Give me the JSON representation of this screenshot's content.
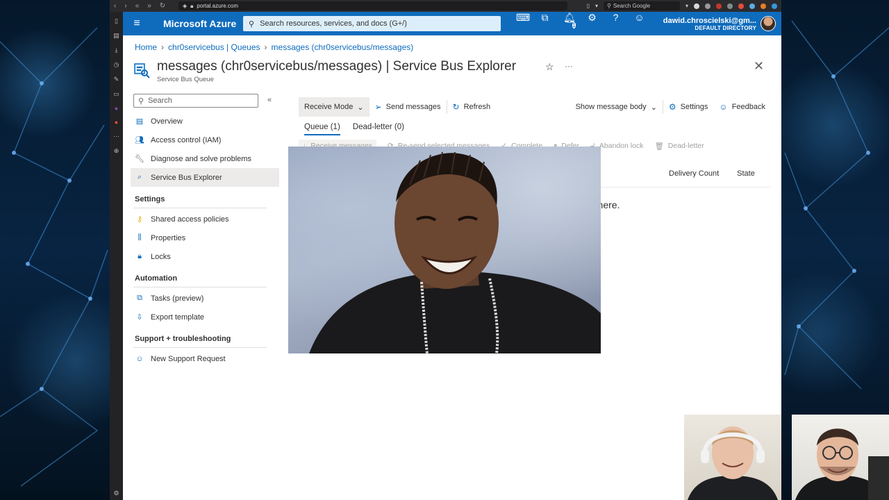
{
  "browser": {
    "url": "portal.azure.com",
    "google_search": "Search Google"
  },
  "topbar": {
    "brand": "Microsoft Azure",
    "search_placeholder": "Search resources, services, and docs (G+/)",
    "notification_count": "1",
    "account_email": "dawid.chroscielski@gm...",
    "account_directory": "DEFAULT DIRECTORY"
  },
  "breadcrumb": {
    "items": [
      "Home",
      "chr0servicebus | Queues",
      "messages (chr0servicebus/messages)"
    ]
  },
  "header": {
    "title": "messages (chr0servicebus/messages) | Service Bus Explorer",
    "subtitle": "Service Bus Queue",
    "more": "···"
  },
  "menu": {
    "search_placeholder": "Search",
    "items": [
      {
        "label": "Overview",
        "icon": "overview-icon"
      },
      {
        "label": "Access control (IAM)",
        "icon": "people-icon"
      },
      {
        "label": "Diagnose and solve problems",
        "icon": "wrench-icon"
      },
      {
        "label": "Service Bus Explorer",
        "icon": "explorer-icon"
      }
    ],
    "sections": [
      {
        "title": "Settings",
        "items": [
          {
            "label": "Shared access policies",
            "icon": "key-icon"
          },
          {
            "label": "Properties",
            "icon": "properties-icon"
          },
          {
            "label": "Locks",
            "icon": "lock-icon"
          }
        ]
      },
      {
        "title": "Automation",
        "items": [
          {
            "label": "Tasks (preview)",
            "icon": "tasks-icon"
          },
          {
            "label": "Export template",
            "icon": "export-icon"
          }
        ]
      },
      {
        "title": "Support + troubleshooting",
        "items": [
          {
            "label": "New Support Request",
            "icon": "support-icon"
          }
        ]
      }
    ]
  },
  "commandbar": {
    "receive_mode": "Receive Mode",
    "send_messages": "Send messages",
    "refresh": "Refresh",
    "show_message_body": "Show message body",
    "settings": "Settings",
    "feedback": "Feedback"
  },
  "tabs": [
    "Queue (1)",
    "Dead-letter (0)"
  ],
  "actions": [
    "Receive messages",
    "Re-send selected messages",
    "Complete",
    "Defer",
    "Abandon lock",
    "Dead-letter"
  ],
  "table": {
    "columns": [
      "Delivery Count",
      "State"
    ],
    "empty_text": "m here."
  },
  "colors": {
    "azure_blue": "#0f6cbd",
    "active_bg": "#edebe9"
  }
}
